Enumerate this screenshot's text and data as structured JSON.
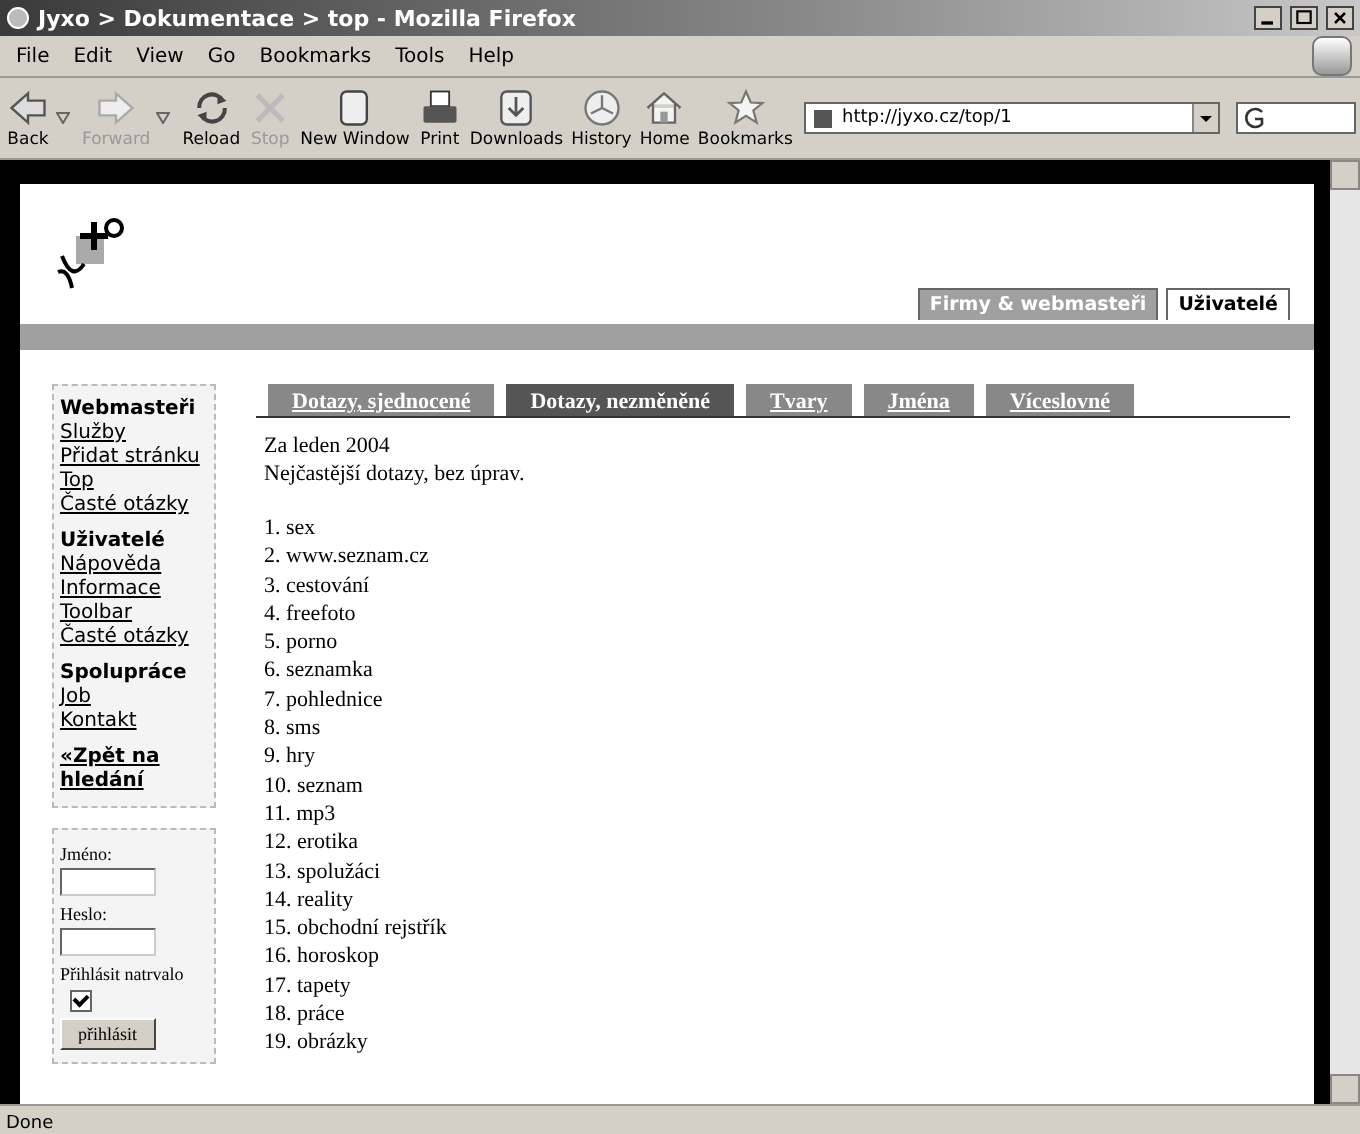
{
  "window": {
    "title": "Jyxo > Dokumentace > top - Mozilla Firefox"
  },
  "menu": [
    "File",
    "Edit",
    "View",
    "Go",
    "Bookmarks",
    "Tools",
    "Help"
  ],
  "toolbar": [
    {
      "kind": "back",
      "label": "Back",
      "disabled": false
    },
    {
      "kind": "forward",
      "label": "Forward",
      "disabled": true
    },
    {
      "kind": "reload",
      "label": "Reload",
      "disabled": false
    },
    {
      "kind": "stop",
      "label": "Stop",
      "disabled": true
    },
    {
      "kind": "newwindow",
      "label": "New Window",
      "disabled": false
    },
    {
      "kind": "print",
      "label": "Print",
      "disabled": false
    },
    {
      "kind": "downloads",
      "label": "Downloads",
      "disabled": false
    },
    {
      "kind": "history",
      "label": "History",
      "disabled": false
    },
    {
      "kind": "home",
      "label": "Home",
      "disabled": false
    },
    {
      "kind": "bookmarks",
      "label": "Bookmarks",
      "disabled": false
    }
  ],
  "address": {
    "value": "http://jyxo.cz/top/1"
  },
  "site_tabs": [
    {
      "label": "Firmy & webmasteři",
      "selected": true
    },
    {
      "label": "Uživatelé",
      "selected": false
    }
  ],
  "sidebar": [
    {
      "heading": "Webmasteři",
      "links": [
        "Služby",
        "Přidat stránku",
        "Top",
        "Časté otázky"
      ]
    },
    {
      "heading": "Uživatelé",
      "links": [
        "Nápověda",
        "Informace",
        "Toolbar",
        "Časté otázky"
      ]
    },
    {
      "heading": "Spolupráce",
      "links": [
        "Job",
        "Kontakt"
      ]
    }
  ],
  "back_link": "«Zpět na hledání",
  "login": {
    "name_label": "Jméno:",
    "password_label": "Heslo:",
    "remember_label": "Přihlásit natrvalo",
    "remember": true,
    "button": "přihlásit"
  },
  "content_tabs": [
    {
      "label": "Dotazy, sjednocené",
      "selected": false
    },
    {
      "label": "Dotazy, nezměněné",
      "selected": true
    },
    {
      "label": "Tvary",
      "selected": false
    },
    {
      "label": "Jména",
      "selected": false
    },
    {
      "label": "Víceslovné",
      "selected": false
    }
  ],
  "period": "Za leden 2004",
  "description": "Nejčastější dotazy, bez úprav.",
  "queries": [
    "1. sex",
    "2. www.seznam.cz",
    "3. cestování",
    "4. freefoto",
    "5. porno",
    "6. seznamka",
    "7. pohlednice",
    "8. sms",
    "9. hry",
    "10. seznam",
    "11. mp3",
    "12. erotika",
    "13. spolužáci",
    "14. reality",
    "15. obchodní rejstřík",
    "16. horoskop",
    "17. tapety",
    "18. práce",
    "19. obrázky"
  ],
  "status_bar": "Done"
}
